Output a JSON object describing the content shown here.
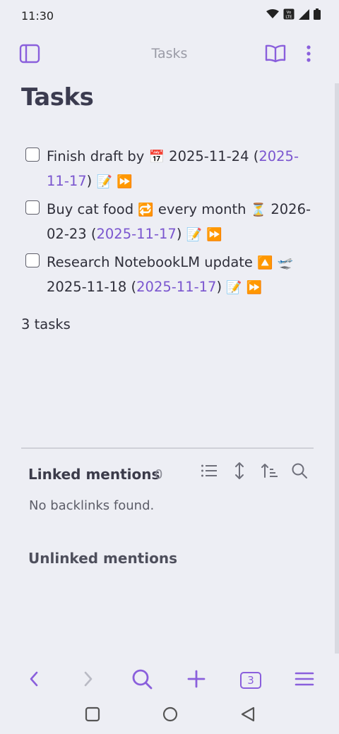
{
  "status_bar": {
    "time": "11:30"
  },
  "header": {
    "title": "Tasks"
  },
  "page": {
    "title": "Tasks"
  },
  "tasks": [
    {
      "text": "Finish draft by",
      "due_icon": "📅",
      "due_date": "2025-11-24",
      "link_date": "2025-11-17",
      "edit_icon": "📝",
      "ff_icon": "⏩"
    },
    {
      "text": "Buy cat food",
      "repeat_icon": "🔁",
      "repeat_text": "every month",
      "sched_icon": "⏳",
      "sched_date": "2026-02-23",
      "link_date": "2025-11-17",
      "edit_icon": "📝",
      "ff_icon": "⏩"
    },
    {
      "text": "Research NotebookLM update",
      "priority_icon": "🔼",
      "start_icon": "🛫",
      "start_date": "2025-11-18",
      "link_date": "2025-11-17",
      "edit_icon": "📝",
      "ff_icon": "⏩"
    }
  ],
  "task_count": "3 tasks",
  "backlinks": {
    "title": "Linked mentions",
    "count": "0",
    "empty_text": "No backlinks found.",
    "unlinked_title": "Unlinked mentions"
  },
  "bottom_nav": {
    "tab_count": "3"
  },
  "colors": {
    "accent": "#8a5fdc",
    "link": "#7a55cf",
    "background": "#edeef4"
  }
}
